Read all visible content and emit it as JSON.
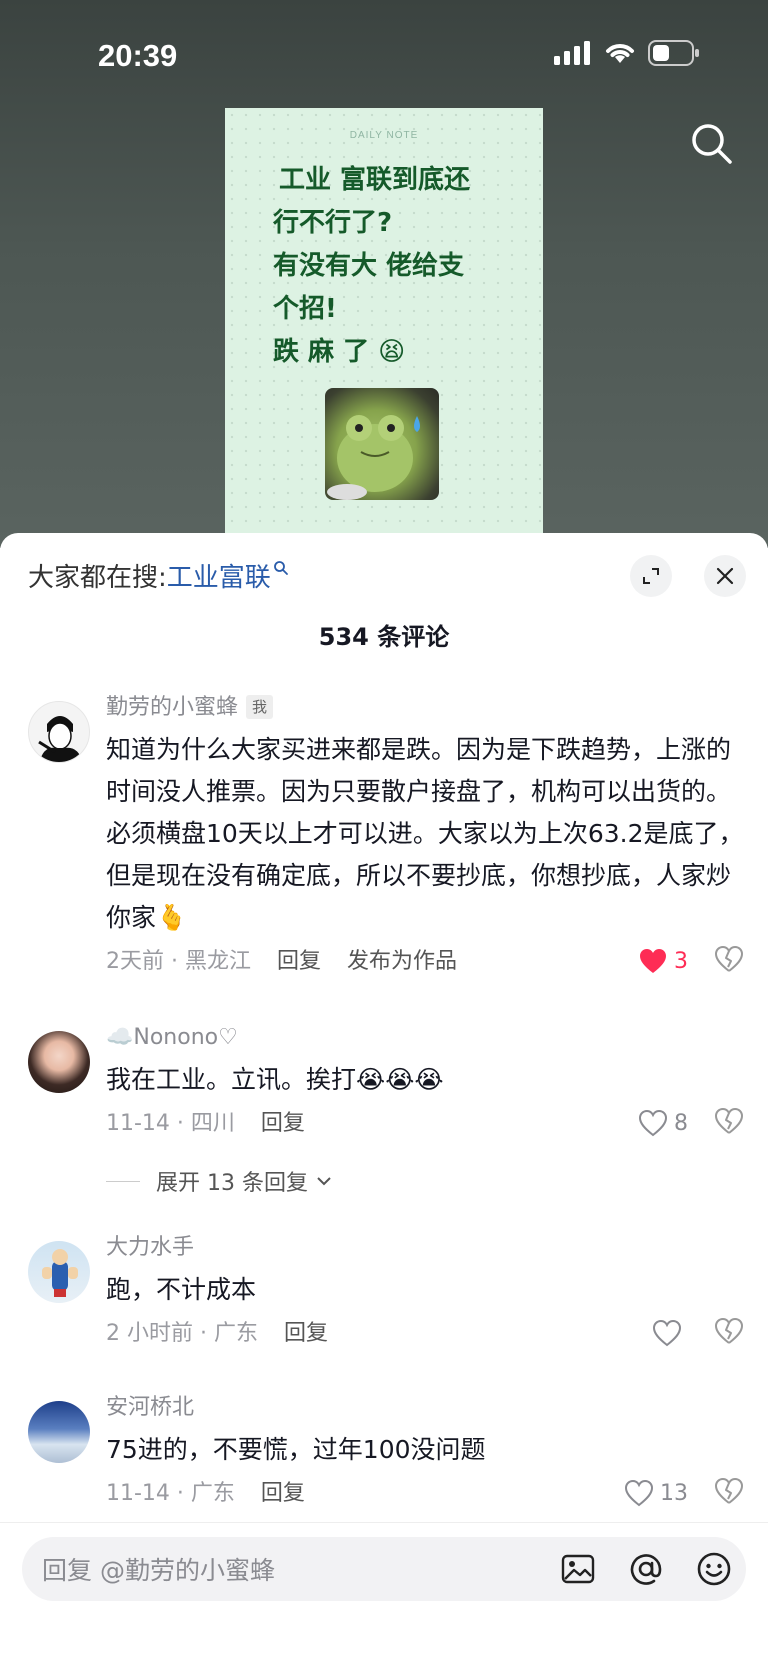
{
  "status_bar": {
    "time": "20:39"
  },
  "note": {
    "header": "DAILY NOTE",
    "lines": [
      " 工业 富联到底还",
      "行不行了?",
      "有没有大 佬给支",
      "个招!",
      "跌 麻 了 😫"
    ]
  },
  "sheet": {
    "search_prefix": "大家都在搜:",
    "search_keyword": "工业富联",
    "count_label": "534 条评论"
  },
  "comments": [
    {
      "username": "勤劳的小蜜蜂",
      "badge": "我",
      "text": "知道为什么大家买进来都是跌。因为是下跌趋势，上涨的时间没人推票。因为只要散户接盘了，机构可以出货的。必须横盘10天以上才可以进。大家以为上次63.2是底了，但是现在没有确定底，所以不要抄底，你想抄底，人家炒你家🫰",
      "time_loc": "2天前 · 黑龙江",
      "reply_label": "回复",
      "publish_label": "发布为作品",
      "likes": "3",
      "liked": true,
      "like_color": "#fe2c55"
    },
    {
      "username": "☁️Nonono♡",
      "text": "我在工业。立讯。挨打😭😭😭",
      "time_loc": "11-14 · 四川",
      "reply_label": "回复",
      "likes": "8",
      "expand_label": "展开 13 条回复"
    },
    {
      "username": "大力水手",
      "text": "跑，不计成本",
      "time_loc": "2 小时前 · 广东",
      "reply_label": "回复",
      "likes": ""
    },
    {
      "username": "安河桥北",
      "text": "75进的，不要慌，过年100没问题",
      "time_loc": "11-14 · 广东",
      "reply_label": "回复",
      "likes": "13"
    }
  ],
  "reply_bar": {
    "placeholder": "回复 @勤劳的小蜜蜂"
  },
  "colors": {
    "accent_red": "#fe2c55",
    "link_blue": "#2a5caa",
    "note_green": "#155a2a"
  }
}
